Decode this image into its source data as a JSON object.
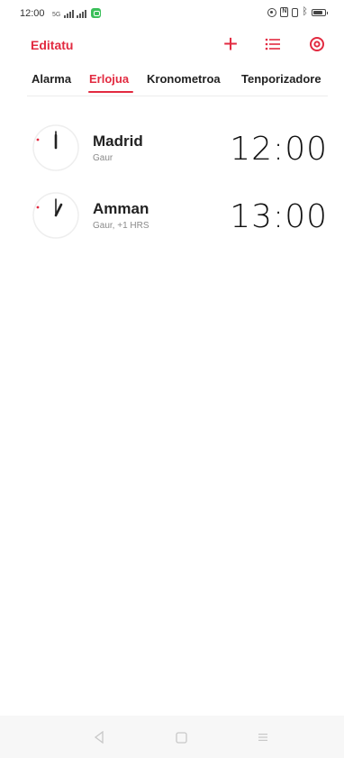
{
  "status_bar": {
    "time": "12:00",
    "network_label": "5G",
    "battery_level": 0.85
  },
  "toolbar": {
    "edit_label": "Editatu",
    "add_icon": "plus-icon",
    "list_icon": "list-icon",
    "settings_icon": "settings-icon",
    "accent_color": "#e22a40"
  },
  "tabs": [
    {
      "label": "Alarma",
      "active": false
    },
    {
      "label": "Erlojua",
      "active": true
    },
    {
      "label": "Kronometroa",
      "active": false
    },
    {
      "label": "Tenporizadore",
      "active": false
    }
  ],
  "clocks": [
    {
      "city": "Madrid",
      "subtitle": "Gaur",
      "time": "12:00"
    },
    {
      "city": "Amman",
      "subtitle": "Gaur, +1 HRS",
      "time": "13:00"
    }
  ],
  "nav_bar": {
    "back_icon": "back-triangle-icon",
    "home_icon": "home-square-icon",
    "menu_icon": "menu-lines-icon"
  }
}
